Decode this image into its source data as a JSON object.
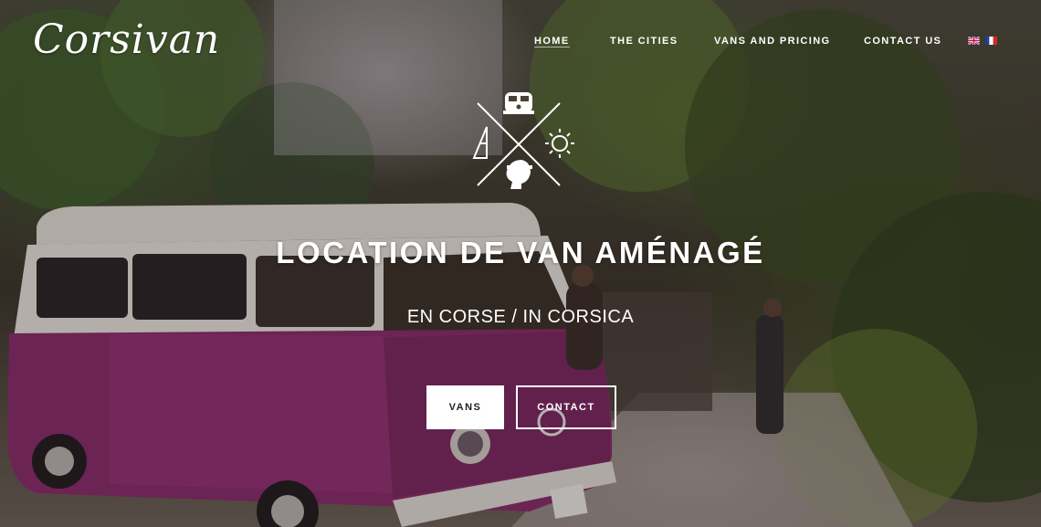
{
  "brand": {
    "logo_text": "Corsivan"
  },
  "nav": {
    "items": [
      {
        "label": "HOME",
        "active": true
      },
      {
        "label": "THE CITIES",
        "active": false
      },
      {
        "label": "VANS AND PRICING",
        "active": false
      },
      {
        "label": "CONTACT US",
        "active": false
      }
    ],
    "languages": [
      "english-flag",
      "french-flag"
    ]
  },
  "hero": {
    "title": "LOCATION DE VAN AMÉNAGÉ",
    "subtitle": "EN CORSE / IN CORSICA",
    "buttons": {
      "vans_label": "VANS",
      "contact_label": "CONTACT"
    },
    "emblem_icons": [
      "van-icon",
      "sun-icon",
      "moor-head-icon",
      "tent-icon"
    ]
  },
  "colors": {
    "van_body": "#8a2a6a",
    "accent_white": "#ffffff",
    "foliage": "#4b6a2e"
  }
}
